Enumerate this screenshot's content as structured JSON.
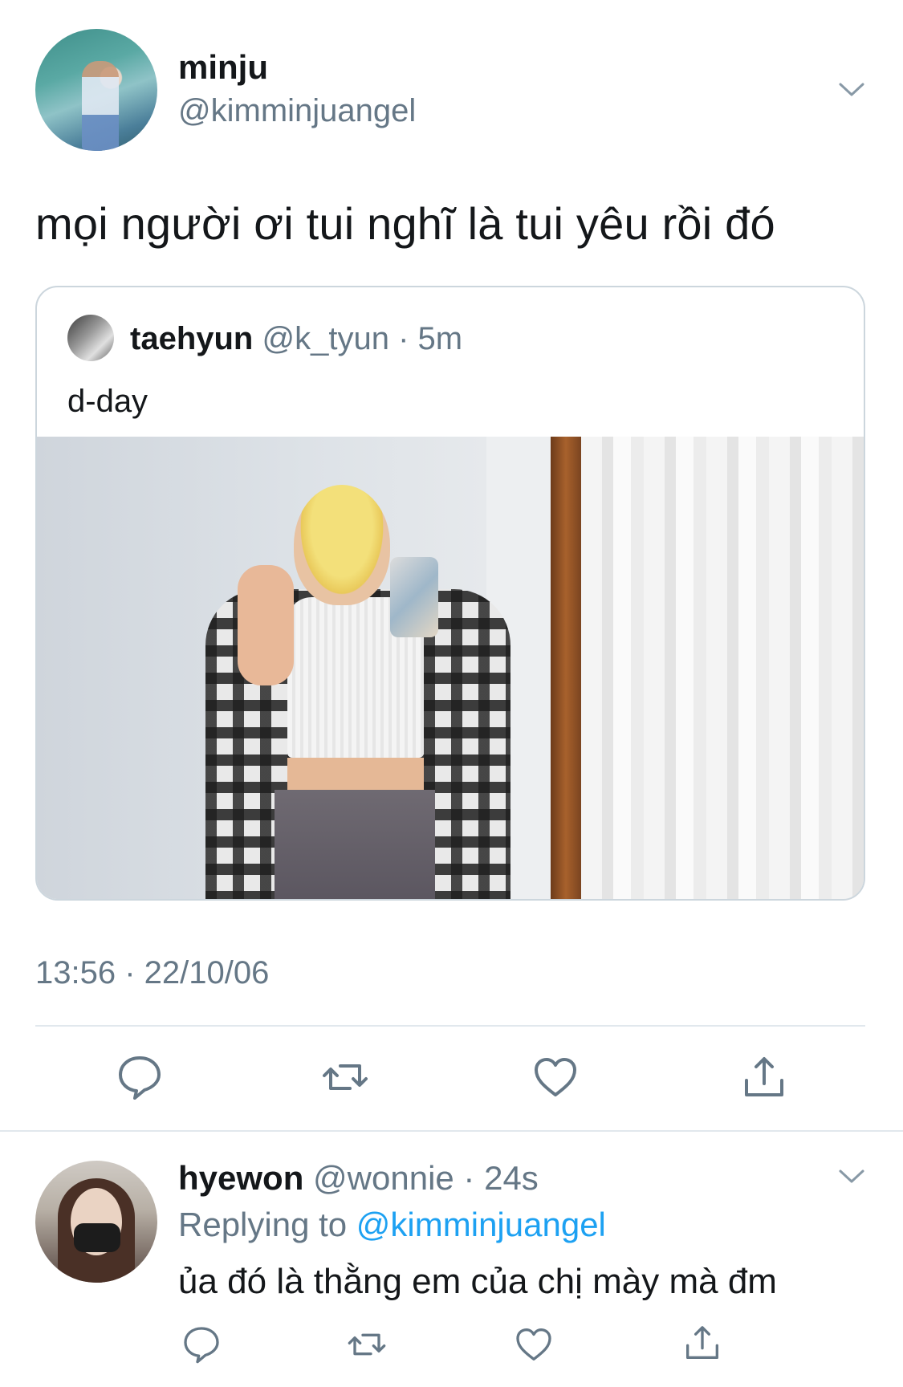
{
  "tweet": {
    "author_name": "minju",
    "author_handle": "@kimminjuangel",
    "text": "mọi người ơi tui nghĩ là tui yêu rồi đó",
    "timestamp": "13:56 · 22/10/06",
    "quoted": {
      "author_name": "taehyun",
      "author_handle": "@k_tyun",
      "time": "5m",
      "text": "d-day"
    },
    "actions": [
      "reply-icon",
      "retweet-icon",
      "like-icon",
      "share-icon"
    ]
  },
  "reply": {
    "author_name": "hyewon",
    "author_handle": "@wonnie",
    "time": "24s",
    "replying_label": "Replying to",
    "replying_to": "@kimminjuangel",
    "text": "ủa đó là thằng em của chị mày mà đm",
    "actions": [
      "reply-icon",
      "retweet-icon",
      "like-icon",
      "share-icon"
    ]
  },
  "colors": {
    "text": "#14171a",
    "secondary": "#657786",
    "link": "#1da1f2",
    "divider": "#e1e8ed"
  }
}
